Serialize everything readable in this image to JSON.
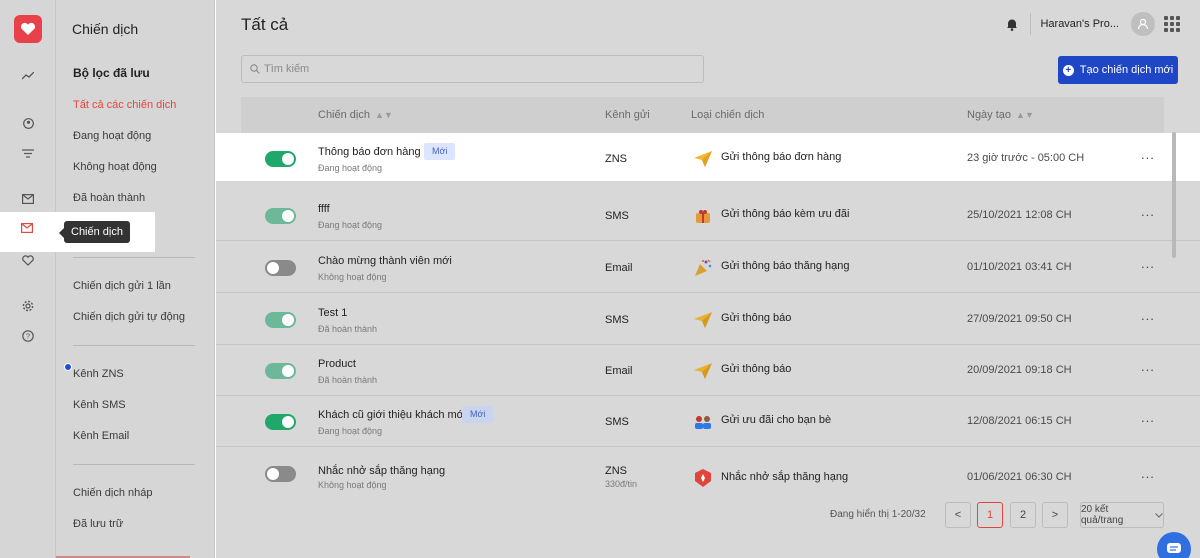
{
  "sidebar": {
    "title": "Chiến dịch",
    "saved_filters_heading": "Bộ lọc đã lưu",
    "filters": [
      {
        "label": "Tất cả các chiến dịch"
      },
      {
        "label": "Đang hoạt động"
      },
      {
        "label": "Không hoạt động"
      },
      {
        "label": "Đã hoàn thành"
      }
    ],
    "campaign_types": [
      {
        "label": "Chiến dịch gửi 1 lần"
      },
      {
        "label": "Chiến dịch gửi tự động"
      }
    ],
    "channels": [
      {
        "label": "Kênh ZNS"
      },
      {
        "label": "Kênh SMS"
      },
      {
        "label": "Kênh Email"
      }
    ],
    "misc": [
      {
        "label": "Chiến dịch nháp"
      },
      {
        "label": "Đã lưu trữ"
      }
    ],
    "tooltip": "Chiến dịch"
  },
  "header": {
    "title": "Tất cả",
    "shop_name": "Haravan's Pro..."
  },
  "search": {
    "placeholder": "Tìm kiếm"
  },
  "create_button": "Tạo chiến dịch mới",
  "table": {
    "columns": {
      "campaign": "Chiến dịch",
      "channel": "Kênh gửi",
      "type": "Loại chiến dịch",
      "created": "Ngày tạo"
    },
    "rows": [
      {
        "name": "Thông báo đơn hàng",
        "badge": "Mới",
        "status": "Đang hoạt động",
        "enabled": true,
        "channel": "ZNS",
        "channel_sub": "",
        "type": "Gửi thông báo đơn hàng",
        "type_icon": "paper-plane-icon",
        "date": "23 giờ trước - 05:00 CH"
      },
      {
        "name": "ffff",
        "badge": "",
        "status": "Đang hoạt động",
        "enabled": true,
        "channel": "SMS",
        "channel_sub": "",
        "type": "Gửi thông báo kèm ưu đãi",
        "type_icon": "gift-icon",
        "date": "25/10/2021 12:08 CH"
      },
      {
        "name": "Chào mừng thành viên mới",
        "badge": "",
        "status": "Không hoạt động",
        "enabled": false,
        "channel": "Email",
        "channel_sub": "",
        "type": "Gửi thông báo thăng hạng",
        "type_icon": "party-popper-icon",
        "date": "01/10/2021 03:41 CH"
      },
      {
        "name": "Test 1",
        "badge": "",
        "status": "Đã hoàn thành",
        "enabled": true,
        "channel": "SMS",
        "channel_sub": "",
        "type": "Gửi thông báo",
        "type_icon": "paper-plane-icon",
        "date": "27/09/2021 09:50 CH"
      },
      {
        "name": "Product",
        "badge": "",
        "status": "Đã hoàn thành",
        "enabled": true,
        "channel": "Email",
        "channel_sub": "",
        "type": "Gửi thông báo",
        "type_icon": "paper-plane-icon",
        "date": "20/09/2021 09:18 CH"
      },
      {
        "name": "Khách cũ giới thiệu khách mới",
        "badge": "Mới",
        "status": "Đang hoạt động",
        "enabled": true,
        "channel": "SMS",
        "channel_sub": "",
        "type": "Gửi ưu đãi cho bạn bè",
        "type_icon": "friends-icon",
        "date": "12/08/2021 06:15 CH"
      },
      {
        "name": "Nhắc nhở sắp thăng hạng",
        "badge": "",
        "status": "Không hoạt động",
        "enabled": false,
        "channel": "ZNS",
        "channel_sub": "330đ/tin",
        "type": "Nhắc nhở sắp thăng hạng",
        "type_icon": "rank-badge-icon",
        "date": "01/06/2021 06:30 CH"
      }
    ],
    "more_label": "..."
  },
  "pagination": {
    "info": "Đang hiển thị 1-20/32",
    "prev": "<",
    "pages": [
      "1",
      "2"
    ],
    "next": ">",
    "per_page": "20 kết quả/trang"
  },
  "colors": {
    "accent": "#e0483f",
    "primary": "#1f46c4",
    "toggle_on": "#1fa86a"
  }
}
